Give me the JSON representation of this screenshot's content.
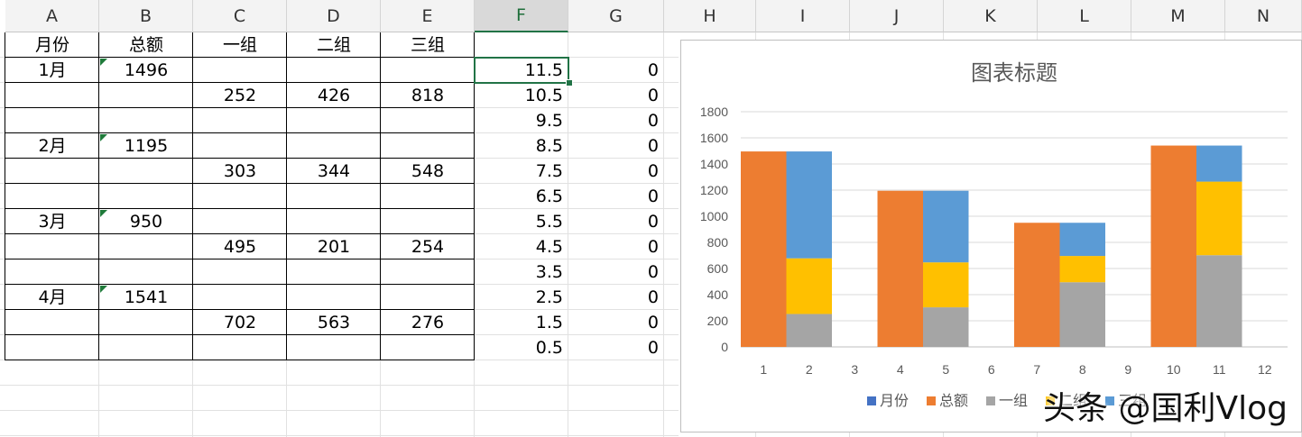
{
  "columns": [
    "A",
    "B",
    "C",
    "D",
    "E",
    "F",
    "G",
    "H",
    "I",
    "J",
    "K",
    "L",
    "M",
    "N"
  ],
  "header_row": {
    "month": "月份",
    "total": "总额",
    "g1": "一组",
    "g2": "二组",
    "g3": "三组"
  },
  "months": [
    {
      "label": "1月",
      "total": "1496",
      "g1": "252",
      "g2": "426",
      "g3": "818"
    },
    {
      "label": "2月",
      "total": "1195",
      "g1": "303",
      "g2": "344",
      "g3": "548"
    },
    {
      "label": "3月",
      "total": "950",
      "g1": "495",
      "g2": "201",
      "g3": "254"
    },
    {
      "label": "4月",
      "total": "1541",
      "g1": "702",
      "g2": "563",
      "g3": "276"
    }
  ],
  "col_f": [
    "11.5",
    "10.5",
    "9.5",
    "8.5",
    "7.5",
    "6.5",
    "5.5",
    "4.5",
    "3.5",
    "2.5",
    "1.5",
    "0.5"
  ],
  "col_g": [
    "0",
    "0",
    "0",
    "0",
    "0",
    "0",
    "0",
    "0",
    "0",
    "0",
    "0",
    "0"
  ],
  "selected_column": "F",
  "chart_data": {
    "type": "bar",
    "stacked": true,
    "title": "图表标题",
    "categories": [
      "1",
      "2",
      "3",
      "4",
      "5",
      "6",
      "7",
      "8",
      "9",
      "10",
      "11",
      "12"
    ],
    "ylim": [
      0,
      1800
    ],
    "yticks": [
      "0",
      "200",
      "400",
      "600",
      "800",
      "1000",
      "1200",
      "1400",
      "1600",
      "1800"
    ],
    "grid": true,
    "legend_position": "bottom",
    "series": [
      {
        "name": "月份",
        "color": "#4472c4",
        "values": [
          0,
          0,
          0,
          0,
          0,
          0,
          0,
          0,
          0,
          0,
          0,
          0
        ]
      },
      {
        "name": "总额",
        "color": "#ed7d31",
        "values": [
          1496,
          0,
          0,
          1195,
          0,
          0,
          950,
          0,
          0,
          1541,
          0,
          0
        ]
      },
      {
        "name": "一组",
        "color": "#a5a5a5",
        "values": [
          0,
          252,
          0,
          0,
          303,
          0,
          0,
          495,
          0,
          0,
          702,
          0
        ]
      },
      {
        "name": "二组",
        "color": "#ffc000",
        "values": [
          0,
          426,
          0,
          0,
          344,
          0,
          0,
          201,
          0,
          0,
          563,
          0
        ]
      },
      {
        "name": "三组",
        "color": "#5b9bd5",
        "values": [
          0,
          818,
          0,
          0,
          548,
          0,
          0,
          254,
          0,
          0,
          276,
          0
        ]
      }
    ]
  },
  "watermark": "头条 @国利Vlog"
}
